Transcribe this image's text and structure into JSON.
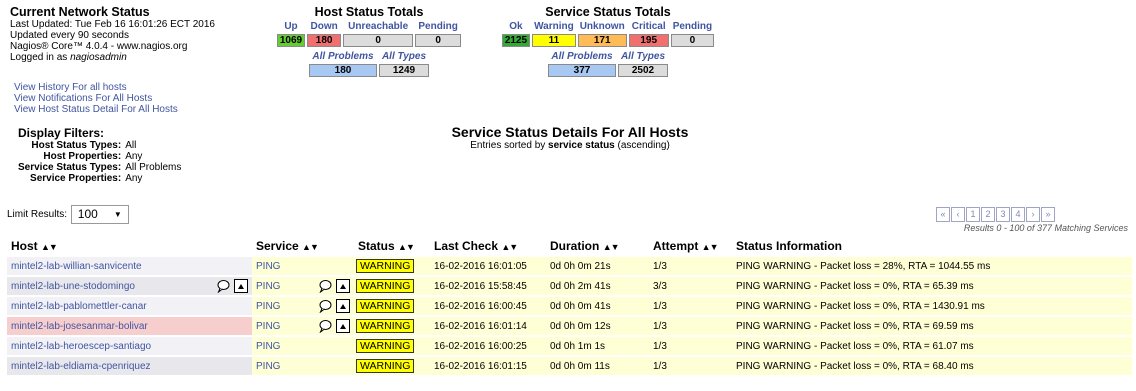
{
  "header": {
    "title": "Current Network Status",
    "last_updated": "Last Updated: Tue Feb 16 16:01:26 ECT 2016",
    "update_every": "Updated every 90 seconds",
    "version": "Nagios® Core™ 4.0.4 - www.nagios.org",
    "logged_prefix": "Logged in as ",
    "logged_user": "nagiosadmin"
  },
  "links": [
    "View History For all hosts",
    "View Notifications For All Hosts",
    "View Host Status Detail For All Hosts"
  ],
  "host_totals": {
    "title": "Host Status Totals",
    "labels": [
      "Up",
      "Down",
      "Unreachable",
      "Pending"
    ],
    "values": [
      "1069",
      "180",
      "0",
      "0"
    ],
    "colors": [
      "#66cc33",
      "#f07070",
      "#dcdcdc",
      "#dcdcdc"
    ],
    "sub_labels": [
      "All Problems",
      "All Types"
    ],
    "sub_values": [
      "180",
      "1249"
    ],
    "sub_colors": [
      "#a6c8f2",
      "#dcdcdc"
    ]
  },
  "service_totals": {
    "title": "Service Status Totals",
    "labels": [
      "Ok",
      "Warning",
      "Unknown",
      "Critical",
      "Pending"
    ],
    "values": [
      "2125",
      "11",
      "171",
      "195",
      "0"
    ],
    "colors": [
      "#33aa33",
      "#ffff00",
      "#ffbb55",
      "#f07070",
      "#dcdcdc"
    ],
    "sub_labels": [
      "All Problems",
      "All Types"
    ],
    "sub_values": [
      "377",
      "2502"
    ],
    "sub_colors": [
      "#a6c8f2",
      "#dcdcdc"
    ]
  },
  "filters": {
    "title": "Display Filters:",
    "rows": [
      {
        "k": "Host Status Types:",
        "v": "All"
      },
      {
        "k": "Host Properties:",
        "v": "Any"
      },
      {
        "k": "Service Status Types:",
        "v": "All Problems"
      },
      {
        "k": "Service Properties:",
        "v": "Any"
      }
    ]
  },
  "center": {
    "title": "Service Status Details For All Hosts",
    "sub_prefix": "Entries sorted by ",
    "sub_bold": "service status",
    "sub_suffix": " (ascending)"
  },
  "limit": {
    "label": "Limit Results:",
    "value": "100"
  },
  "pager": {
    "pages": [
      "1",
      "2",
      "3",
      "4"
    ],
    "results": "Results 0 - 100 of 377 Matching Services"
  },
  "columns": [
    "Host",
    "Service",
    "Status",
    "Last Check",
    "Duration",
    "Attempt",
    "Status Information"
  ],
  "rows": [
    {
      "host": "mintel2-lab-willian-sanvicente",
      "service": "PING",
      "status": "WARNING",
      "last_check": "16-02-2016 16:01:05",
      "duration": "0d 0h 0m 21s",
      "attempt": "1/3",
      "info": "PING WARNING - Packet loss = 28%, RTA = 1044.55 ms"
    },
    {
      "host": "mintel2-lab-une-stodomingo",
      "service": "PING",
      "status": "WARNING",
      "last_check": "16-02-2016 15:58:45",
      "duration": "0d 0h 2m 41s",
      "attempt": "3/3",
      "info": "PING WARNING - Packet loss = 0%, RTA = 65.39 ms"
    },
    {
      "host": "mintel2-lab-pablomettler-canar",
      "service": "PING",
      "status": "WARNING",
      "last_check": "16-02-2016 16:00:45",
      "duration": "0d 0h 0m 41s",
      "attempt": "1/3",
      "info": "PING WARNING - Packet loss = 0%, RTA = 1430.91 ms"
    },
    {
      "host": "mintel2-lab-josesanmar-bolivar",
      "service": "PING",
      "status": "WARNING",
      "last_check": "16-02-2016 16:01:14",
      "duration": "0d 0h 0m 12s",
      "attempt": "1/3",
      "info": "PING WARNING - Packet loss = 0%, RTA = 69.59 ms"
    },
    {
      "host": "mintel2-lab-heroescep-santiago",
      "service": "PING",
      "status": "WARNING",
      "last_check": "16-02-2016 16:00:25",
      "duration": "0d 0h 1m 1s",
      "attempt": "1/3",
      "info": "PING WARNING - Packet loss = 0%, RTA = 61.07 ms"
    },
    {
      "host": "mintel2-lab-eldiama-cpenriquez",
      "service": "PING",
      "status": "WARNING",
      "last_check": "16-02-2016 16:01:15",
      "duration": "0d 0h 0m 11s",
      "attempt": "1/3",
      "info": "PING WARNING - Packet loss = 0%, RTA = 68.40 ms"
    }
  ]
}
